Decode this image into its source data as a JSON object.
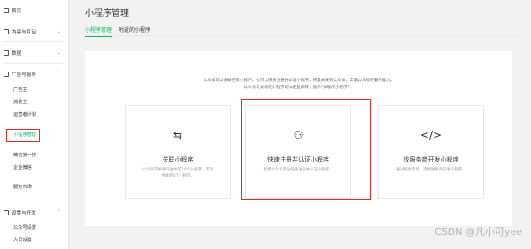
{
  "sidebar": {
    "items": [
      {
        "label": "首页",
        "icon": "home-icon",
        "name": "sidebar-item-home",
        "chevron": ""
      },
      {
        "label": "内容与互动",
        "icon": "content-icon",
        "name": "sidebar-item-content",
        "chevron": "⌄"
      },
      {
        "label": "数据",
        "icon": "data-icon",
        "name": "sidebar-item-data",
        "chevron": "⌄"
      },
      {
        "label": "广告与服务",
        "icon": "ad-icon",
        "name": "sidebar-item-ads",
        "chevron": "⌃"
      }
    ],
    "ads_sub": [
      "广告主",
      "流量主",
      "运营者计划",
      "小程序管理"
    ],
    "ads_sub2": [
      "微信第一搜",
      "企业微信",
      "服务市场"
    ],
    "settings": {
      "label": "设置与开发",
      "icon": "settings-icon",
      "chevron": "⌃"
    },
    "settings_sub": [
      "公众号设置",
      "人员设置"
    ]
  },
  "header": {
    "title": "小程序管理",
    "tabs": [
      "小程序管理",
      "附近的小程序"
    ]
  },
  "intro": {
    "line1": "公众号可以关联已有小程序，也可以快速注册并认证小程序，将其关联到公众号，丰富公众号的服务能力。",
    "line2": "公众号与关联的小程序可以相互跳转，展示“关联的小程序”。"
  },
  "cards": [
    {
      "icon": "⇆",
      "title": "关联小程序",
      "desc": "公众号可关联同主体的10个小程序，不同主体的3个小程序。"
    },
    {
      "icon": "⚇",
      "title": "快速注册并认证小程序",
      "desc": "复用公众号资质快速注册并认证小程序。"
    },
    {
      "icon": "</>",
      "title": "找服务商开发小程序",
      "desc": "通过服务市场，选择服务商开发小程序。"
    }
  ],
  "watermark": "CSDN @凡小可yee",
  "colors": {
    "accent": "#07c160",
    "highlight": "#e02b2b"
  }
}
